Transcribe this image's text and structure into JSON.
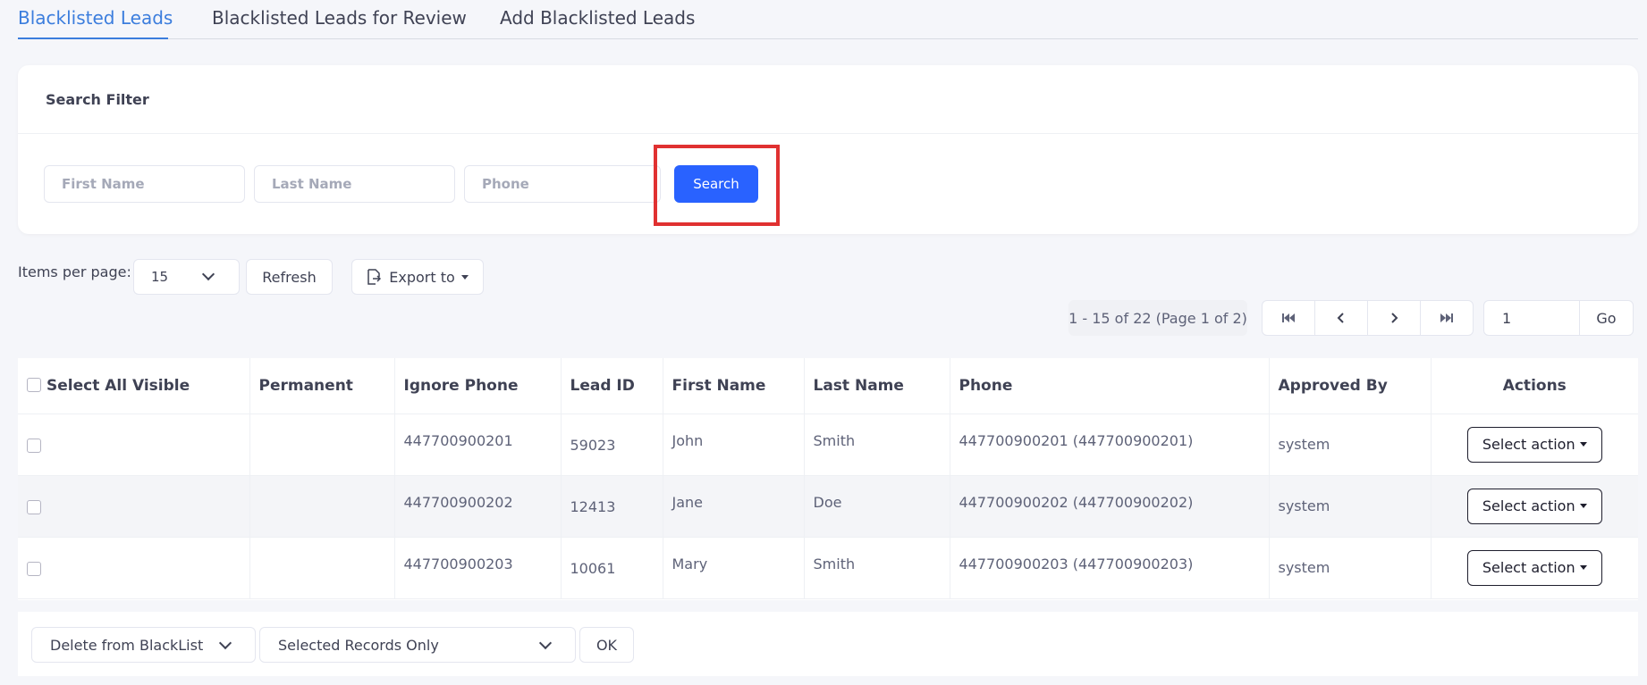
{
  "tabs": [
    {
      "label": "Blacklisted Leads",
      "active": true
    },
    {
      "label": "Blacklisted Leads for Review",
      "active": false
    },
    {
      "label": "Add Blacklisted Leads",
      "active": false
    }
  ],
  "filter": {
    "title": "Search Filter",
    "first_name_placeholder": "First Name",
    "last_name_placeholder": "Last Name",
    "phone_placeholder": "Phone",
    "search_label": "Search"
  },
  "controls": {
    "items_per_page_label": "Items per page:",
    "items_per_page_value": "15",
    "refresh_label": "Refresh",
    "export_label": "Export to"
  },
  "pagination": {
    "info": "1 - 15 of 22 (Page 1 of 2)",
    "page_input": "1",
    "go_label": "Go"
  },
  "table": {
    "headers": {
      "select_all": "Select All Visible",
      "permanent": "Permanent",
      "ignore_phone": "Ignore Phone",
      "lead_id": "Lead ID",
      "first_name": "First Name",
      "last_name": "Last Name",
      "phone": "Phone",
      "approved_by": "Approved By",
      "actions": "Actions"
    },
    "rows": [
      {
        "permanent": "",
        "ignore_phone": "447700900201",
        "lead_id": "59023",
        "first_name": "John",
        "last_name": "Smith",
        "phone": "447700900201 (447700900201)",
        "approved_by": "system",
        "action": "Select action"
      },
      {
        "permanent": "",
        "ignore_phone": "447700900202",
        "lead_id": "12413",
        "first_name": "Jane",
        "last_name": "Doe",
        "phone": "447700900202 (447700900202)",
        "approved_by": "system",
        "action": "Select action"
      },
      {
        "permanent": "",
        "ignore_phone": "447700900203",
        "lead_id": "10061",
        "first_name": "Mary",
        "last_name": "Smith",
        "phone": "447700900203 (447700900203)",
        "approved_by": "system",
        "action": "Select action"
      }
    ]
  },
  "bulk": {
    "action_value": "Delete from BlackList",
    "scope_value": "Selected Records Only",
    "ok_label": "OK"
  },
  "colors": {
    "accent": "#2962ff",
    "active_tab": "#3b7ddd",
    "highlight": "#e03131",
    "background": "#f5f6fa"
  }
}
